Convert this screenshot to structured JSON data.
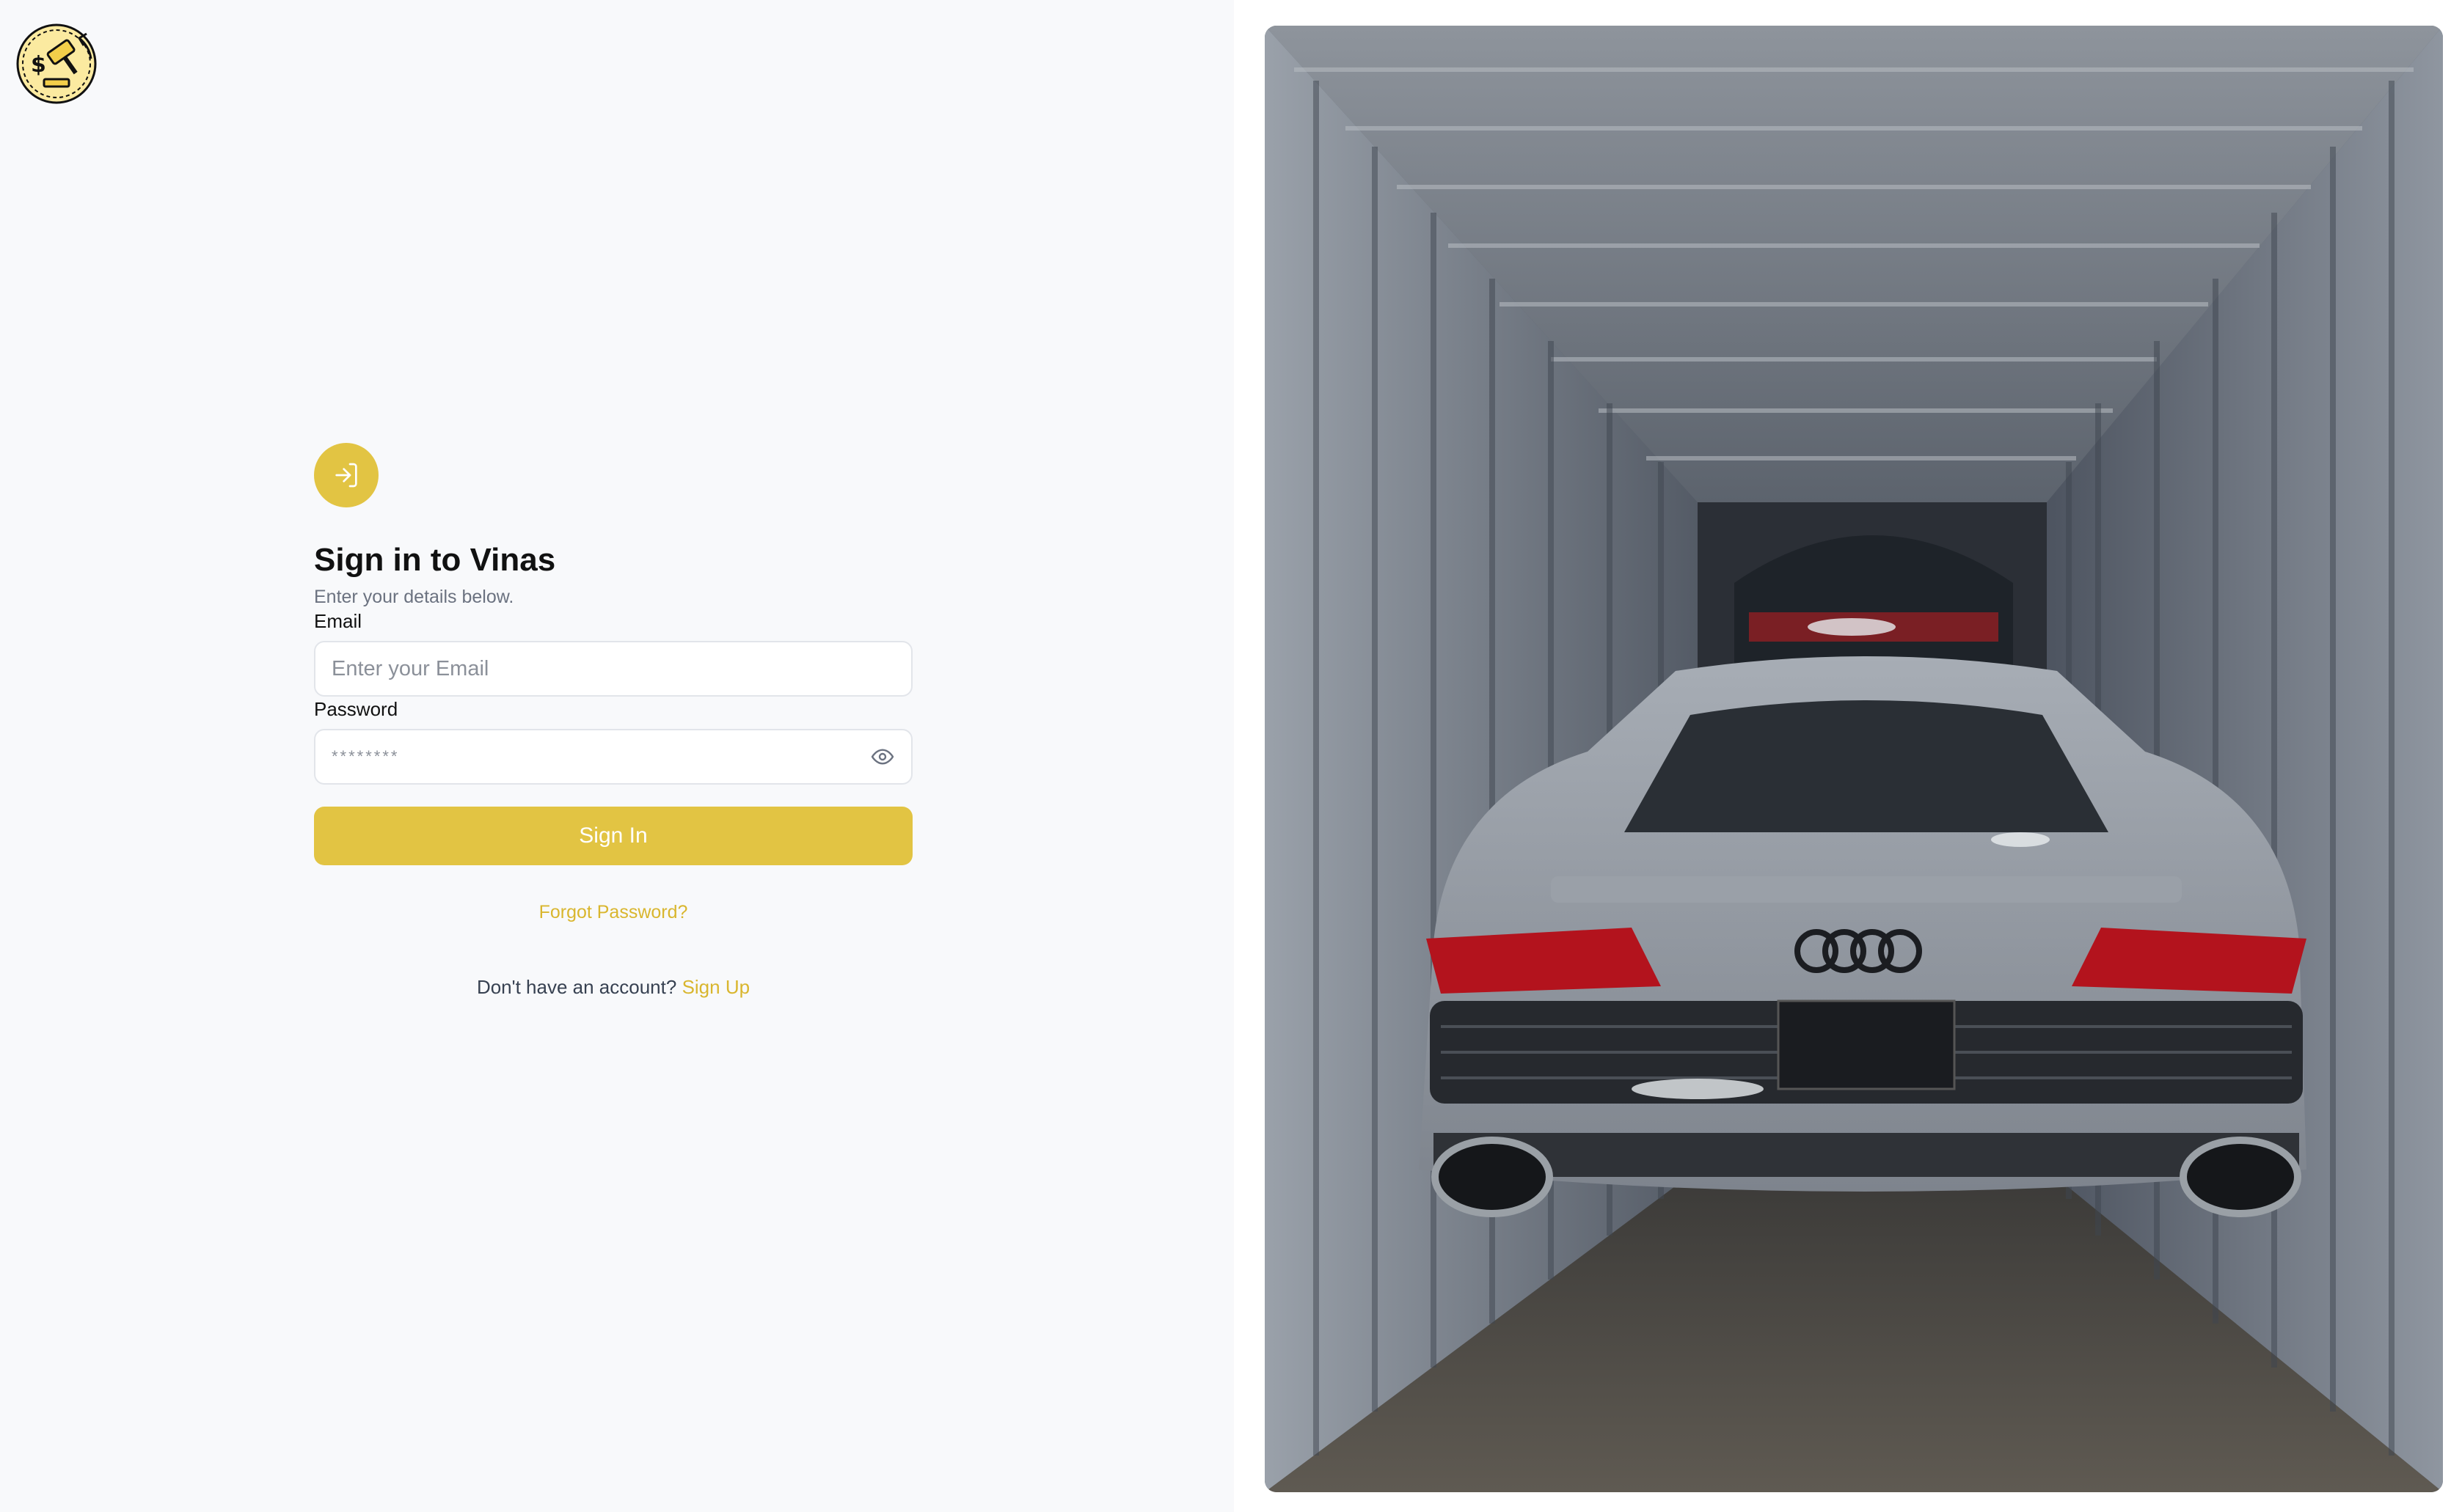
{
  "brand": {
    "logo_icon": "auction-gavel-coin-icon",
    "accent_color": "#e2c443",
    "link_color": "#d9b62e"
  },
  "signin": {
    "badge_icon": "sign-in-arrow-icon",
    "title": "Sign in to Vinas",
    "subtitle": "Enter your details below.",
    "email": {
      "label": "Email",
      "placeholder": "Enter your Email",
      "value": ""
    },
    "password": {
      "label": "Password",
      "placeholder": "********",
      "value": "",
      "toggle_icon": "eye-icon"
    },
    "submit_label": "Sign In",
    "forgot_label": "Forgot Password?",
    "no_account_text": "Don't have an account?",
    "signup_label": "Sign Up"
  },
  "hero": {
    "image_subject": "Grey Audi R8 sports car loaded inside a corrugated shipping container"
  }
}
